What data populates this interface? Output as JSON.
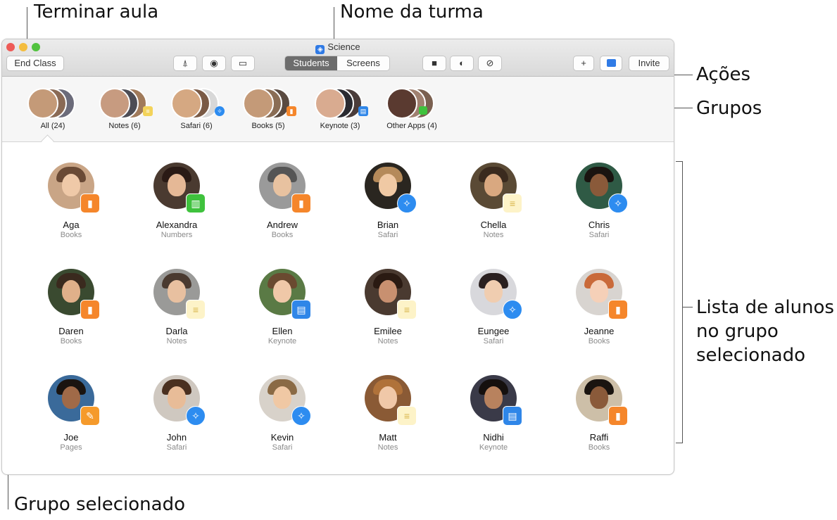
{
  "callouts": {
    "end_class": "Terminar aula",
    "class_name": "Nome da turma",
    "actions": "Ações",
    "groups": "Grupos",
    "student_list_1": "Lista de alunos",
    "student_list_2": "no grupo",
    "student_list_3": "selecionado",
    "selected_group": "Grupo selecionado"
  },
  "window": {
    "title": "Science",
    "title_icon": "science-app-icon",
    "end_class_label": "End Class",
    "tabs": [
      "Students",
      "Screens"
    ],
    "active_tab": "Students",
    "invite_label": "Invite",
    "toolbar_icons": [
      "app-store-icon",
      "compass-icon",
      "airplay-icon",
      "lock-icon",
      "eye-hidden-icon",
      "mute-icon",
      "plus-icon",
      "classroom-icon"
    ]
  },
  "groups": [
    {
      "label": "All (24)",
      "badge": "",
      "selected": true
    },
    {
      "label": "Notes (6)",
      "badge": "notes"
    },
    {
      "label": "Safari (6)",
      "badge": "safari"
    },
    {
      "label": "Books (5)",
      "badge": "books"
    },
    {
      "label": "Keynote (3)",
      "badge": "keynote"
    },
    {
      "label": "Other Apps (4)",
      "badge": "other"
    }
  ],
  "students": [
    {
      "name": "Aga",
      "app": "Books"
    },
    {
      "name": "Alexandra",
      "app": "Numbers"
    },
    {
      "name": "Andrew",
      "app": "Books"
    },
    {
      "name": "Brian",
      "app": "Safari"
    },
    {
      "name": "Chella",
      "app": "Notes"
    },
    {
      "name": "Chris",
      "app": "Safari"
    },
    {
      "name": "Daren",
      "app": "Books"
    },
    {
      "name": "Darla",
      "app": "Notes"
    },
    {
      "name": "Ellen",
      "app": "Keynote"
    },
    {
      "name": "Emilee",
      "app": "Notes"
    },
    {
      "name": "Eungee",
      "app": "Safari"
    },
    {
      "name": "Jeanne",
      "app": "Books"
    },
    {
      "name": "Joe",
      "app": "Pages"
    },
    {
      "name": "John",
      "app": "Safari"
    },
    {
      "name": "Kevin",
      "app": "Safari"
    },
    {
      "name": "Matt",
      "app": "Notes"
    },
    {
      "name": "Nidhi",
      "app": "Keynote"
    },
    {
      "name": "Raffi",
      "app": "Books"
    }
  ],
  "colors": {
    "books": "#f5862b",
    "safari": "#2d8cf0",
    "notes": "#f3d35a",
    "keynote": "#2f86e8",
    "numbers": "#3fc23d",
    "pages": "#f59a2b",
    "active_tab": "#6d6d6d"
  }
}
